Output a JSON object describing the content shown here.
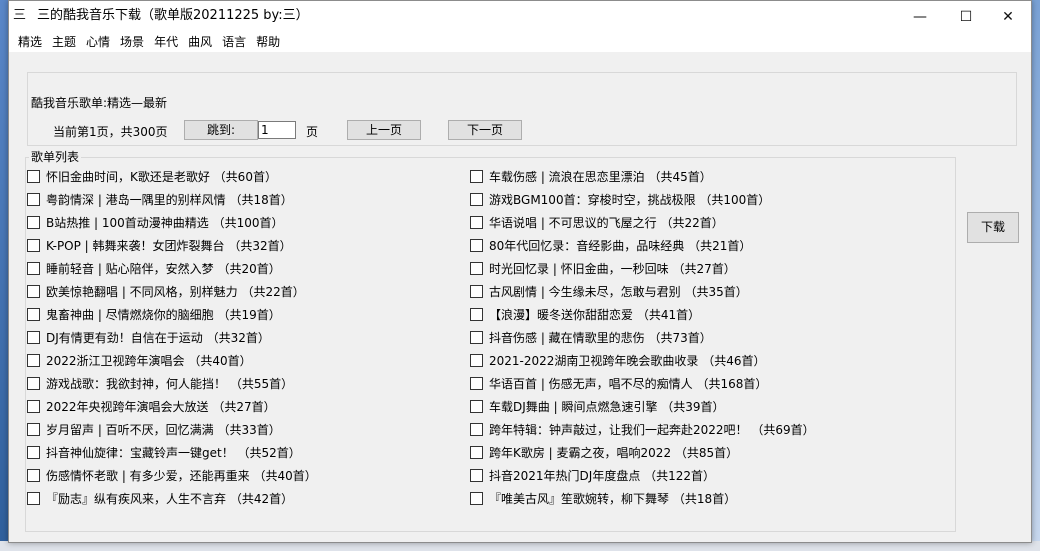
{
  "window": {
    "title": "三的酷我音乐下载（歌单版20211225 by:三）",
    "icon": "app-logo-icon",
    "controls": {
      "minimize": "—",
      "maximize": "☐",
      "close": "✕"
    }
  },
  "menu": [
    "精选",
    "主题",
    "心情",
    "场景",
    "年代",
    "曲风",
    "语言",
    "帮助"
  ],
  "header": {
    "playlist_title": "酷我音乐歌单:精选—最新",
    "page_info": "当前第1页，共300页",
    "jump_label": "跳到:",
    "page_value": "1",
    "page_unit": "页",
    "prev_label": "上一页",
    "next_label": "下一页"
  },
  "list": {
    "legend": "歌单列表",
    "left": [
      "怀旧金曲时间，K歌还是老歌好 （共60首）",
      "粤韵情深 | 港岛一隅里的别样风情 （共18首）",
      "B站热推 | 100首动漫神曲精选 （共100首）",
      "K-POP | 韩舞来袭！女团炸裂舞台 （共32首）",
      "睡前轻音 | 贴心陪伴，安然入梦 （共20首）",
      "欧美惊艳翻唱 | 不同风格，别样魅力 （共22首）",
      "鬼畜神曲 | 尽情燃烧你的脑细胞 （共19首）",
      "DJ有情更有劲！自信在于运动 （共32首）",
      "2022浙江卫视跨年演唱会 （共40首）",
      "游戏战歌：我欲封神，何人能挡！ （共55首）",
      "2022年央视跨年演唱会大放送 （共27首）",
      "岁月留声 | 百听不厌，回忆满满 （共33首）",
      "抖音神仙旋律：宝藏铃声一键get！ （共52首）",
      "伤感情怀老歌 | 有多少爱，还能再重来 （共40首）",
      "『励志』纵有疾风来，人生不言弃 （共42首）"
    ],
    "right": [
      "车载伤感 | 流浪在思恋里漂泊 （共45首）",
      "游戏BGM100首：穿梭时空，挑战极限 （共100首）",
      "华语说唱 | 不可思议的飞屋之行 （共22首）",
      "80年代回忆录：音经影曲，品味经典 （共21首）",
      "时光回忆录 | 怀旧金曲，一秒回味 （共27首）",
      "古风剧情 | 今生缘未尽，怎敢与君别 （共35首）",
      "【浪漫】暖冬送你甜甜恋爱 （共41首）",
      "抖音伤感 | 藏在情歌里的悲伤 （共73首）",
      "2021-2022湖南卫视跨年晚会歌曲收录 （共46首）",
      "华语百首 | 伤感无声，唱不尽的痴情人 （共168首）",
      "车载DJ舞曲 | 瞬间点燃急速引擎 （共39首）",
      "跨年特辑：钟声敲过，让我们一起奔赴2022吧！ （共69首）",
      "跨年K歌房 | 麦霸之夜，唱响2022 （共85首）",
      "抖音2021年热门DJ年度盘点 （共122首）",
      "『唯美古风』笙歌婉转，柳下舞琴 （共18首）"
    ]
  },
  "download_label": "下载",
  "colors": {
    "window_bg": "#f0f0f0",
    "titlebar_bg": "#ffffff",
    "button_bg": "#e1e1e1",
    "desktop": "#3a6ea5"
  }
}
